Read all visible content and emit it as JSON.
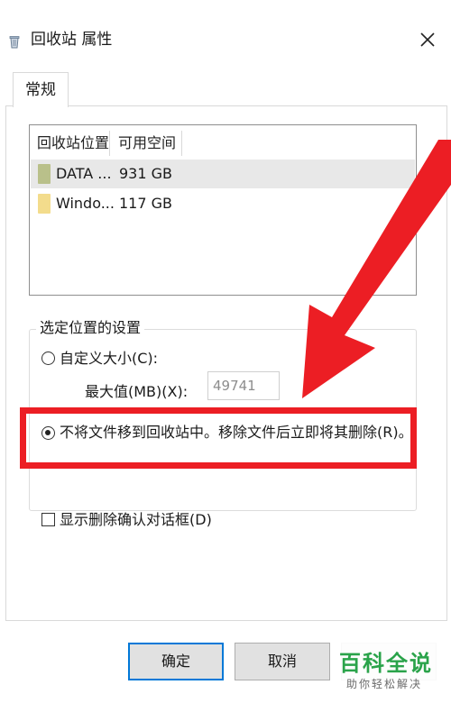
{
  "window": {
    "title": "回收站 属性",
    "icon": "recycle-bin-icon",
    "close_icon": "close-icon"
  },
  "tabs": [
    {
      "label": "常规",
      "active": true
    }
  ],
  "locations_list": {
    "columns": [
      "回收站位置",
      "可用空间"
    ],
    "rows": [
      {
        "name": "DATA ...",
        "free_space": "931 GB",
        "icon": "drive-icon",
        "icon_color": "#b9c08a",
        "selected": true
      },
      {
        "name": "Windo...",
        "free_space": "117 GB",
        "icon": "drive-icon",
        "icon_color": "#f3dc8c",
        "selected": false
      }
    ]
  },
  "settings": {
    "group_label": "选定位置的设置",
    "custom_size_label": "自定义大小(C):",
    "custom_size_checked": false,
    "max_size_label": "最大值(MB)(X):",
    "max_size_value": "49741",
    "no_recycle_label": "不将文件移到回收站中。移除文件后立即将其删除(R)。",
    "no_recycle_checked": true
  },
  "confirm_delete": {
    "label": "显示删除确认对话框(D)",
    "checked": false
  },
  "buttons": {
    "ok": "确定",
    "cancel": "取消"
  },
  "annotation": {
    "color": "#ec1e24"
  },
  "watermark": {
    "logo": "百科全说",
    "tagline": "助你轻松解决",
    "color": "#2aa34a"
  }
}
